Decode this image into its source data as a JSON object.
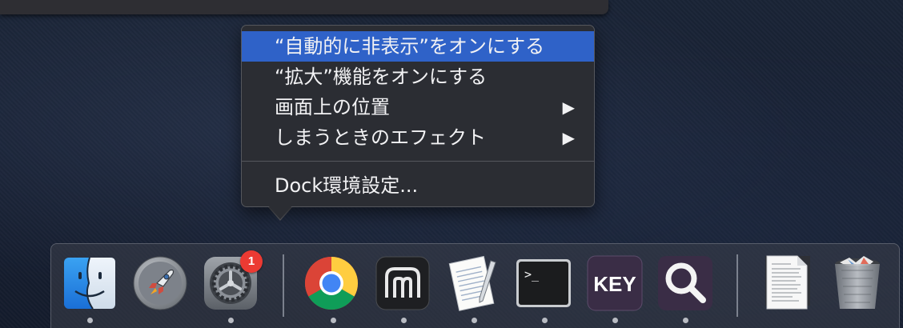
{
  "context_menu": {
    "items": [
      {
        "label": "“自動的に非表示”をオンにする",
        "selected": true
      },
      {
        "label": "“拡大”機能をオンにする"
      },
      {
        "label": "画面上の位置",
        "submenu_arrow": "▶"
      },
      {
        "label": "しまうときのエフェクト",
        "submenu_arrow": "▶"
      }
    ],
    "preferences_label": "Dock環境設定...",
    "highlight_color": "#2f62c8"
  },
  "dock": {
    "apps": [
      {
        "name": "Finder",
        "icon": "finder-icon",
        "running": true
      },
      {
        "name": "Launchpad",
        "icon": "rocket-icon",
        "running": false
      },
      {
        "name": "System Preferences",
        "icon": "gear-icon",
        "running": true,
        "badge": "1"
      },
      {
        "name": "Google Chrome",
        "icon": "chrome-icon",
        "running": true
      },
      {
        "name": "BBEdit",
        "icon": "bbedit-icon",
        "running": true
      },
      {
        "name": "TextEdit",
        "icon": "textedit-icon",
        "running": true
      },
      {
        "name": "Terminal",
        "icon": "terminal-icon",
        "running": true
      },
      {
        "name": "Keycastr",
        "icon": "key-icon",
        "label": "KEY",
        "running": true
      },
      {
        "name": "Search",
        "icon": "magnifier-icon",
        "running": true
      },
      {
        "name": "Document",
        "icon": "document-icon",
        "running": false
      },
      {
        "name": "Trash",
        "icon": "trash-icon",
        "running": false
      }
    ],
    "terminal_prompt": ">_",
    "badge_color": "#ec3a33"
  }
}
